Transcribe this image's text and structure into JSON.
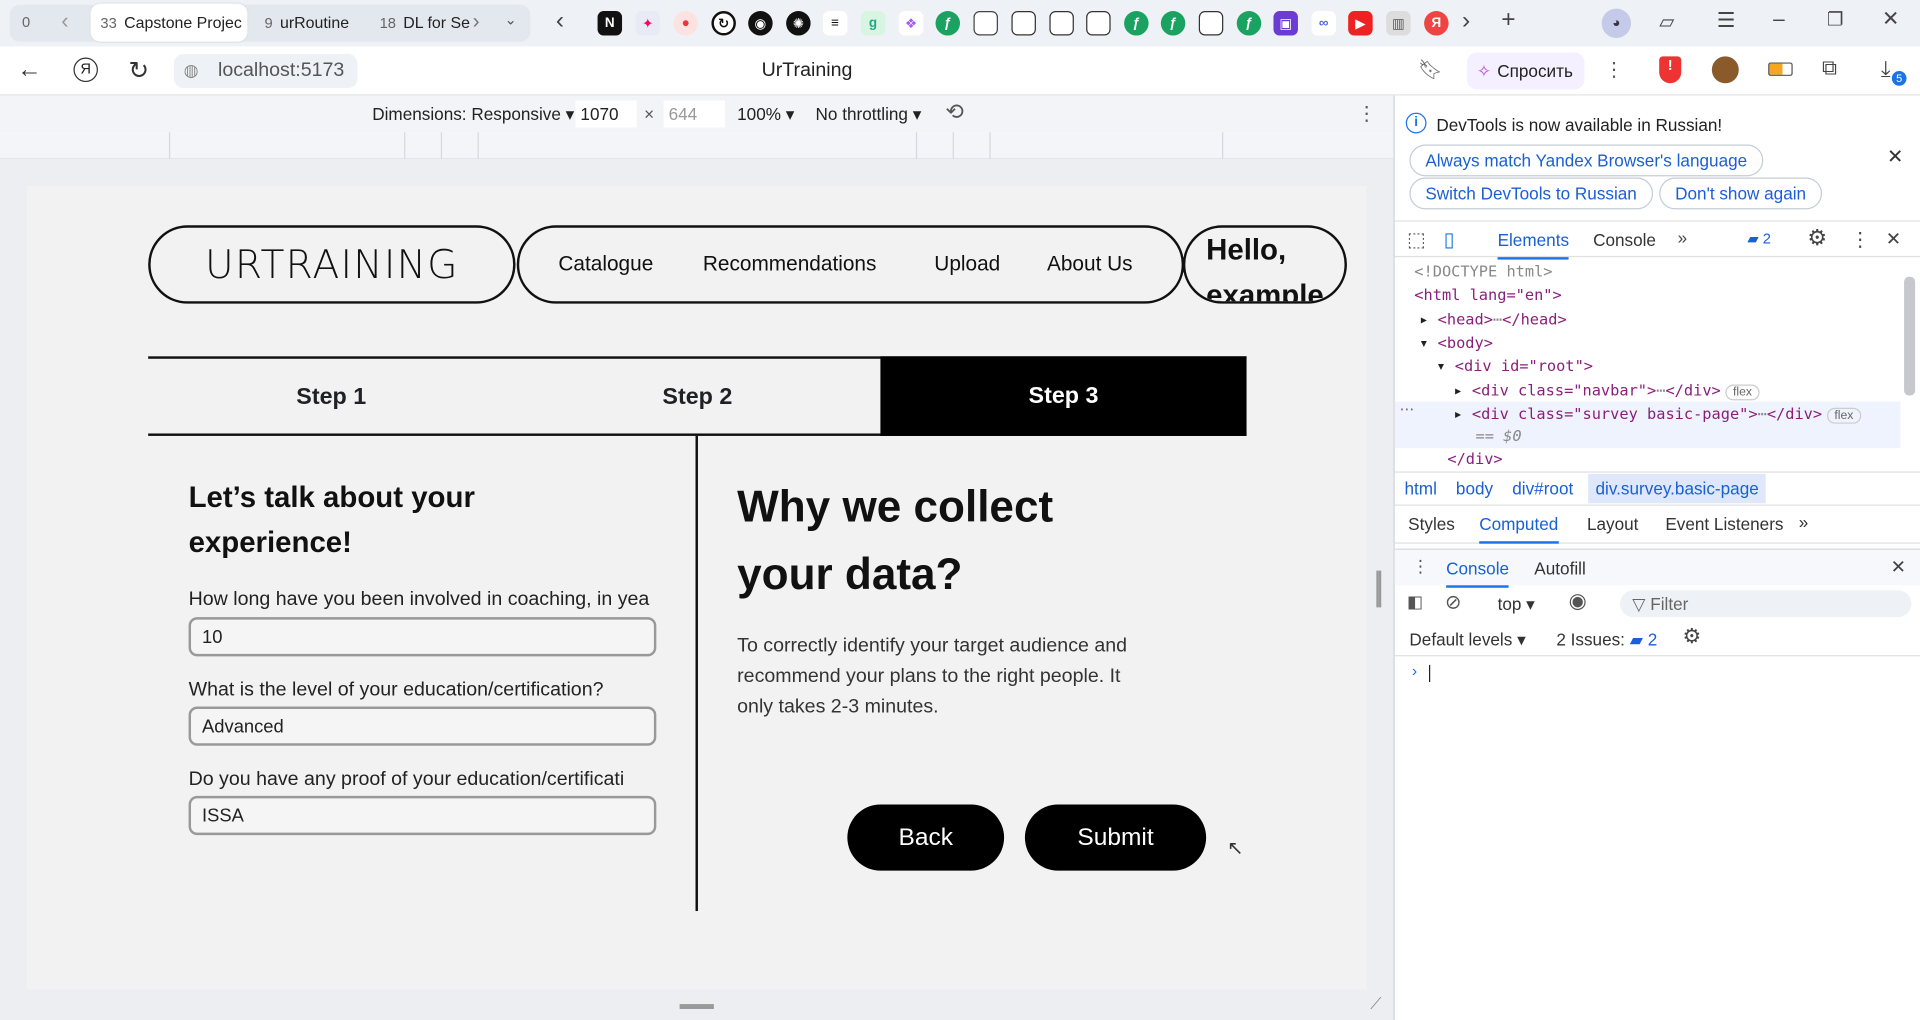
{
  "browser": {
    "tab_counter": "0",
    "tabs": [
      {
        "count": "33",
        "title": "Capstone Projec"
      },
      {
        "count": "9",
        "title": "urRoutine"
      },
      {
        "count": "18",
        "title": "DL for Se"
      }
    ],
    "url": "localhost:5173",
    "page_title": "UrTraining",
    "ask_button": "Спросить",
    "downloads_badge": "5"
  },
  "device_toolbar": {
    "dimensions_label": "Dimensions: Responsive",
    "width": "1070",
    "height_placeholder": "644",
    "zoom": "100%",
    "throttling": "No throttling"
  },
  "site": {
    "logo": "URTRAINING",
    "nav": [
      "Catalogue",
      "Recommendations",
      "Upload",
      "About Us"
    ],
    "greeting_line1": "Hello,",
    "greeting_line2": "example",
    "steps": [
      "Step 1",
      "Step 2",
      "Step 3"
    ],
    "active_step": 3,
    "form_heading_line1": "Let’s talk about your",
    "form_heading_line2": "experience!",
    "questions": [
      {
        "label": "How long have you been involved in coaching, in yea",
        "value": "10"
      },
      {
        "label": "What is the level of your education/certification?",
        "value": "Advanced"
      },
      {
        "label": "Do you have any proof of your education/certificati",
        "value": "ISSA"
      }
    ],
    "info_heading_line1": "Why we collect",
    "info_heading_line2": "your data?",
    "info_text_line1": "To correctly identify your target audience and",
    "info_text_line2": "recommend your plans to the right people. It",
    "info_text_line3": "only takes 2-3 minutes.",
    "back_button": "Back",
    "submit_button": "Submit"
  },
  "devtools": {
    "banner": "DevTools is now available in Russian!",
    "banner_buttons": [
      "Always match Yandex Browser's language",
      "Switch DevTools to Russian",
      "Don't show again"
    ],
    "main_tabs": [
      "Elements",
      "Console"
    ],
    "issues_count": "2",
    "dom": {
      "doctype": "<!DOCTYPE html>",
      "html_open": "<html lang=\"en\">",
      "head": "<head>",
      "head_close": "</head>",
      "body": "<body>",
      "root_div": "<div id=\"root\">",
      "navbar_div": "<div class=\"navbar\">",
      "survey_div": "<div class=\"survey basic-page\">",
      "div_close": "</div>",
      "dollar_zero": "== $0",
      "flex_badge": "flex"
    },
    "breadcrumbs": [
      "html",
      "body",
      "div#root",
      "div.survey.basic-page"
    ],
    "sub_tabs": [
      "Styles",
      "Computed",
      "Layout",
      "Event Listeners"
    ],
    "drawer_tabs": [
      "Console",
      "Autofill"
    ],
    "context": "top",
    "filter_placeholder": "Filter",
    "levels": "Default levels",
    "issues_label": "2 Issues:",
    "issues_badge": "2"
  }
}
